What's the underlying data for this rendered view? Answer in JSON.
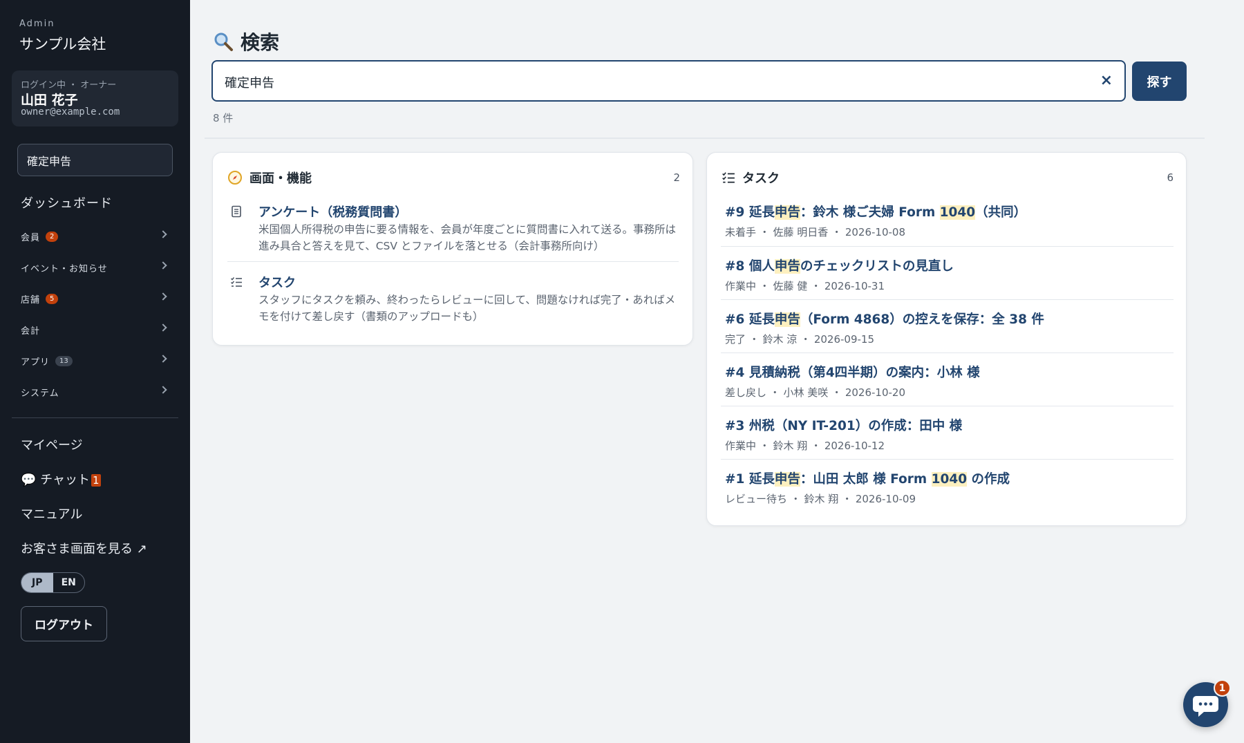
{
  "sidebar": {
    "admin_label": "Admin",
    "org_name": "サンプル会社",
    "user": {
      "status": "ログイン中 ・ オーナー",
      "name": "山田 花子",
      "email": "owner@example.com"
    },
    "search_value": "確定申告",
    "dashboard": "ダッシュボード",
    "nav": [
      {
        "label": "会員",
        "badge": "2"
      },
      {
        "label": "イベント・お知らせ",
        "badge": ""
      },
      {
        "label": "店舗",
        "badge": "5"
      },
      {
        "label": "会計",
        "badge": ""
      },
      {
        "label": "アプリ",
        "badge": "13"
      },
      {
        "label": "システム",
        "badge": ""
      }
    ],
    "mypage": "マイページ",
    "chat": {
      "icon": "💬",
      "label": "チャット",
      "badge": "1"
    },
    "manual": "マニュアル",
    "customer_view": "お客さま画面を見る ↗",
    "lang": {
      "jp": "JP",
      "en": "EN",
      "active": "JP"
    },
    "logout": "ログアウト"
  },
  "main": {
    "title": "検索",
    "search": {
      "value": "確定申告",
      "clear": "×",
      "button": "探す"
    },
    "result_count": "8 件",
    "features": {
      "title": "画面・機能",
      "count": "2",
      "items": [
        {
          "icon": "document-icon",
          "title": "アンケート（税務質問書）",
          "desc": "米国個人所得税の申告に要る情報を、会員が年度ごとに質問書に入れて送る。事務所は進み具合と答えを見て、CSV とファイルを落とせる（会計事務所向け）"
        },
        {
          "icon": "checklist-icon",
          "title": "タスク",
          "desc": "スタッフにタスクを頼み、終わったらレビューに回して、問題なければ完了・あればメモを付けて差し戻す（書類のアップロードも）"
        }
      ]
    },
    "tasks": {
      "title": "タスク",
      "count": "6",
      "items": [
        {
          "pre": "#9 延長",
          "hl": "申告",
          "mid": "：鈴木 様ご夫婦 Form ",
          "hl2": "1040",
          "post": "（共同）",
          "meta": "未着手 ・ 佐藤 明日香 ・ 2026-10-08"
        },
        {
          "pre": "#8 個人",
          "hl": "申告",
          "mid": "のチェックリストの見直し",
          "hl2": "",
          "post": "",
          "meta": "作業中 ・ 佐藤 健 ・ 2026-10-31"
        },
        {
          "pre": "#6 延長",
          "hl": "申告",
          "mid": "（Form 4868）の控えを保存：全 38 件",
          "hl2": "",
          "post": "",
          "meta": "完了 ・ 鈴木 涼 ・ 2026-09-15"
        },
        {
          "pre": "#4 見積納税（第4四半期）の案内：小林 様",
          "hl": "",
          "mid": "",
          "hl2": "",
          "post": "",
          "meta": "差し戻し ・ 小林 美咲 ・ 2026-10-20"
        },
        {
          "pre": "#3 州税（NY IT-201）の作成：田中 様",
          "hl": "",
          "mid": "",
          "hl2": "",
          "post": "",
          "meta": "作業中 ・ 鈴木 翔 ・ 2026-10-12"
        },
        {
          "pre": "#1 延長",
          "hl": "申告",
          "mid": "：山田 太郎 様 Form ",
          "hl2": "1040",
          "post": " の作成",
          "meta": "レビュー待ち ・ 鈴木 翔 ・ 2026-10-09"
        }
      ]
    },
    "chat_fab": {
      "icon": "chat-bubble-icon",
      "badge": "1"
    }
  },
  "colors": {
    "sidebar": "#151b24",
    "accent": "#22456f",
    "badge": "#c2410c",
    "highlight": "#fdf0bf"
  }
}
